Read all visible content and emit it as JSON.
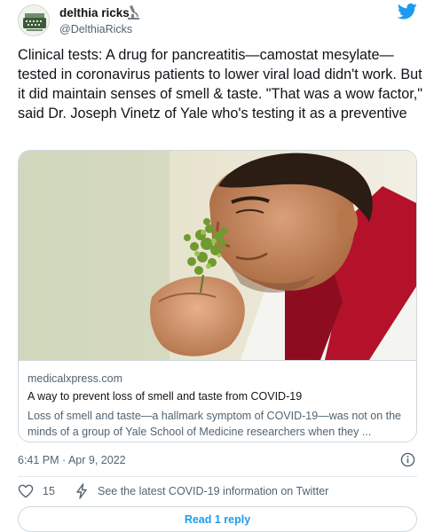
{
  "user": {
    "name": "delthia ricks",
    "handle": "@DelthiaRicks",
    "avatar_icon": "typewriter-icon",
    "badge_icon": "microscope-icon"
  },
  "brand_icon": "twitter-bird-icon",
  "tweet": {
    "text": "Clinical tests: A drug for pancreatitis—camostat mesylate—tested in coronavirus patients to lower viral load didn't work. But it did maintain senses of smell & taste. \"That was a wow factor,\" said Dr. Joseph Vinetz of Yale who's testing it as a preventive"
  },
  "card": {
    "domain": "medicalxpress.com",
    "title": "A way to prevent loss of smell and taste from COVID-19",
    "description": "Loss of smell and taste—a hallmark symptom of COVID-19—was not on the minds of a group of Yale School of Medicine researchers when they ..."
  },
  "meta": {
    "timestamp": "6:41 PM · Apr 9, 2022",
    "info_icon": "info-circle-icon"
  },
  "actions": {
    "like_count": "15",
    "covid_link": "See the latest COVID-19 information on Twitter",
    "read_replies": "Read 1 reply"
  },
  "colors": {
    "accent": "#1d9bf0",
    "text_primary": "#0f1419",
    "text_secondary": "#536471",
    "border": "#cfd9de"
  }
}
